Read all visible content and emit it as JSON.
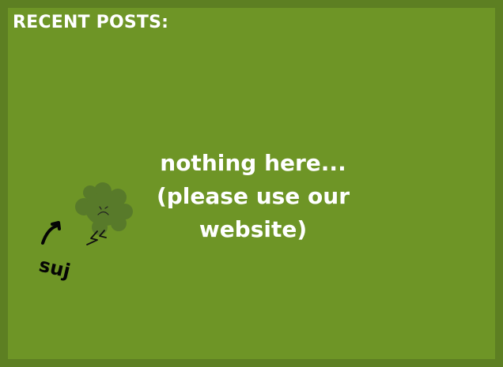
{
  "recent_posts": {
    "title": "RECENT POSTS:",
    "empty_lines": [
      "nothing here...",
      "(please use our",
      "website)"
    ],
    "mascot_note": "suj"
  },
  "colors": {
    "background": "#6e9526",
    "border": "#5d7f22",
    "text": "#ffffff",
    "mascot": "#587a2a",
    "ink": "#000000"
  },
  "icons": {
    "mascot": "sad-clover-mascot-icon",
    "arrow": "curved-arrow-icon"
  }
}
